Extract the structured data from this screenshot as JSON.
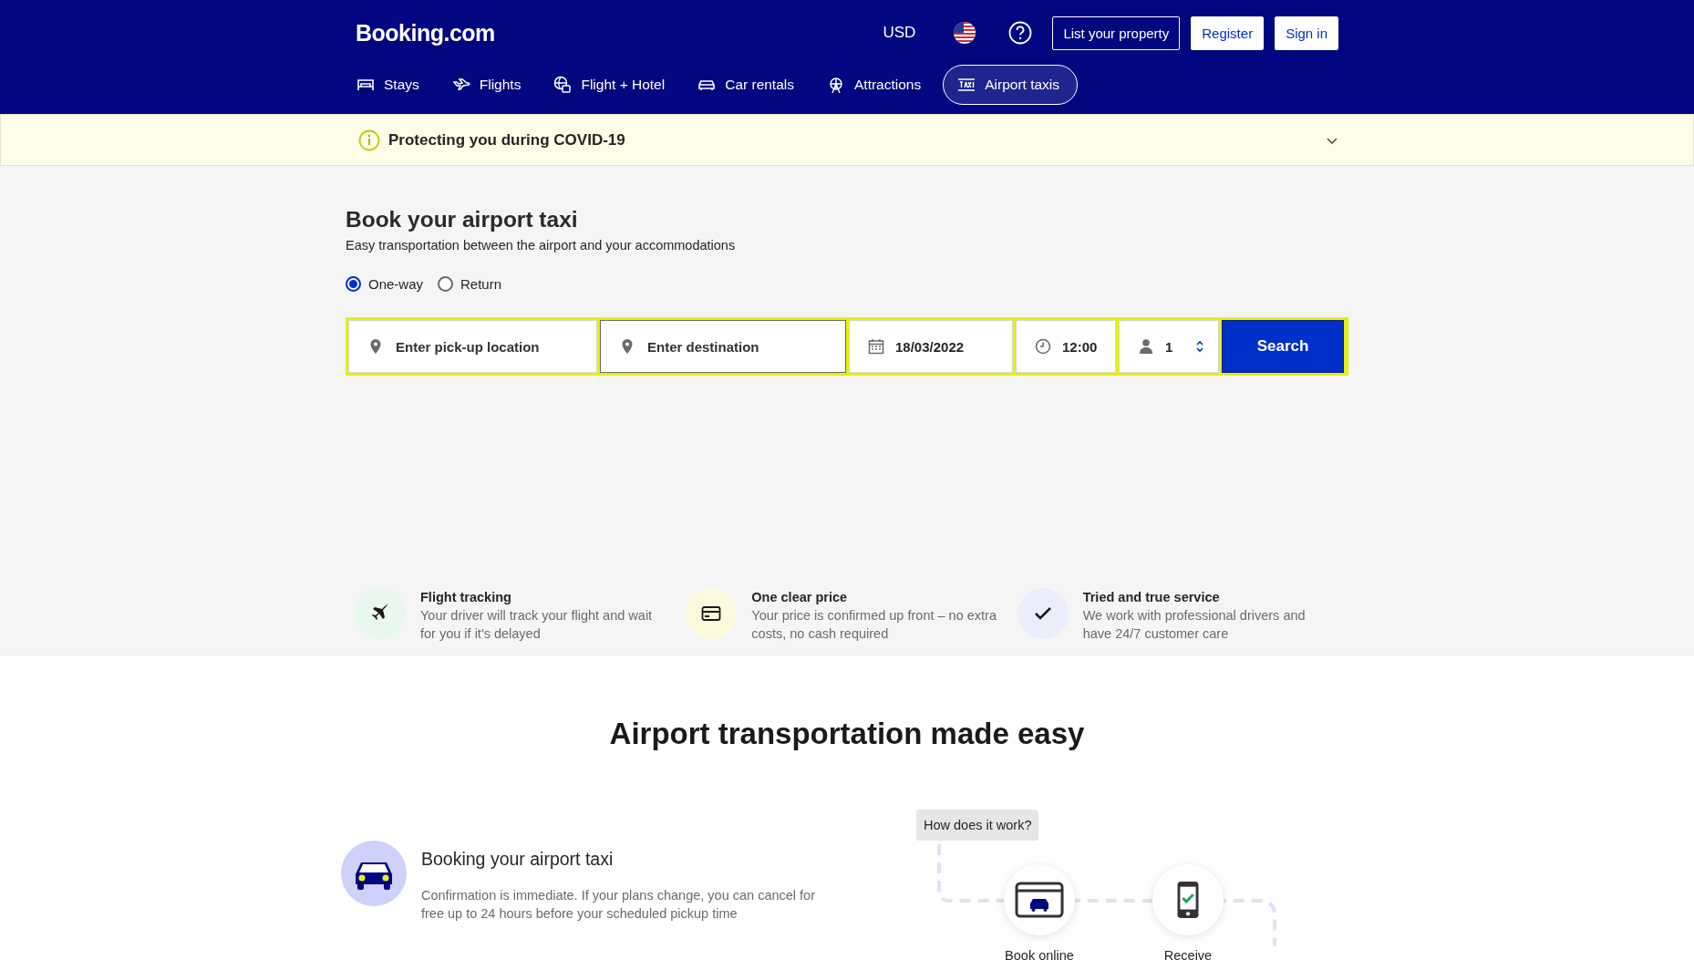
{
  "header": {
    "logo": "Booking.com",
    "currency": "USD",
    "list_property": "List your property",
    "register": "Register",
    "sign_in": "Sign in"
  },
  "nav": [
    {
      "label": "Stays",
      "kind": "bed",
      "selected": false
    },
    {
      "label": "Flights",
      "kind": "plane",
      "selected": false
    },
    {
      "label": "Flight + Hotel",
      "kind": "globe",
      "selected": false
    },
    {
      "label": "Car rentals",
      "kind": "car",
      "selected": false
    },
    {
      "label": "Attractions",
      "kind": "wheel",
      "selected": false
    },
    {
      "label": "Airport taxis",
      "kind": "taxi",
      "selected": true
    }
  ],
  "notice": {
    "title": "Protecting you during COVID-19",
    "expanded": false
  },
  "search": {
    "title": "Book your airport taxi",
    "subtitle": "Easy transportation between the airport and your accommodations",
    "trip_types": [
      {
        "label": "One-way",
        "selected": true
      },
      {
        "label": "Return",
        "selected": false
      }
    ],
    "pickup": {
      "placeholder": "Enter pick-up location"
    },
    "destination": {
      "placeholder": "Enter destination"
    },
    "date": "18/03/2022",
    "time": "12:00",
    "passengers": "1",
    "button": "Search"
  },
  "features": [
    {
      "kind": "plane",
      "color": "#e8f8ee",
      "title": "Flight tracking",
      "text": "Your driver will track your flight and wait for you if it's delayed"
    },
    {
      "kind": "card",
      "color": "#fdf9dc",
      "title": "One clear price",
      "text": "Your price is confirmed up front – no extra costs, no cash required"
    },
    {
      "kind": "check",
      "color": "#ebedfd",
      "title": "Tried and true service",
      "text": "We work with professional drivers and have 24/7 customer care"
    }
  ],
  "section": {
    "title": "Airport transportation made easy",
    "items": [
      {
        "title": "Booking your airport taxi",
        "text": "Confirmation is immediate. If your plans change, you can cancel for free up to 24 hours before your scheduled pickup time"
      }
    ],
    "how": {
      "bubble": "How does it work?",
      "steps": [
        {
          "kind": "browser",
          "label": "Book online"
        },
        {
          "kind": "phone",
          "label": "Receive"
        }
      ]
    }
  }
}
